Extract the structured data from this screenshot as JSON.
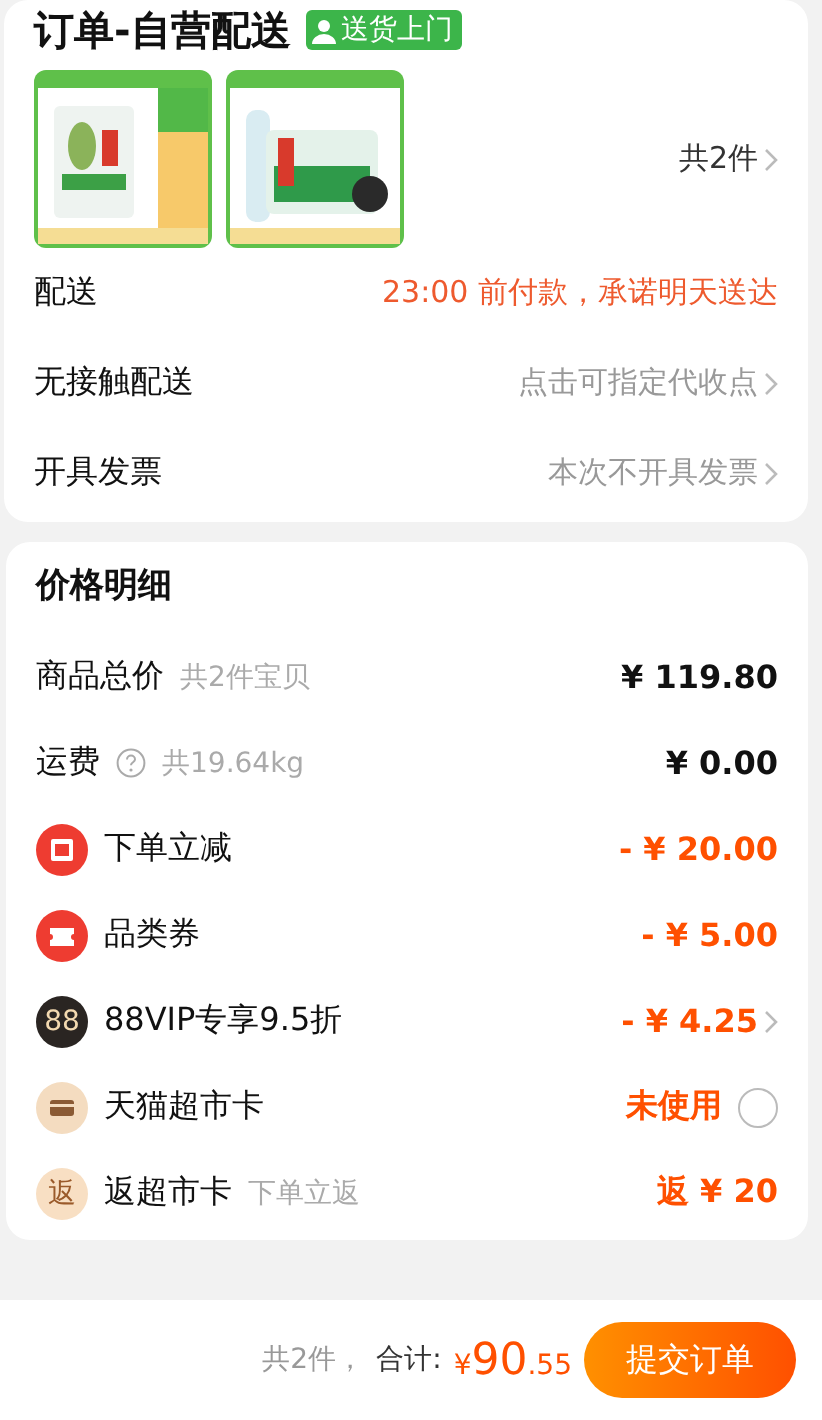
{
  "order": {
    "title": "订单-自营配送",
    "badge": "送货上门",
    "count": "共2件",
    "rows": [
      {
        "label": "配送",
        "value": "23:00 前付款，承诺明天送达",
        "highlight": true,
        "chevron": false
      },
      {
        "label": "无接触配送",
        "value": "点击可指定代收点",
        "highlight": false,
        "chevron": true
      },
      {
        "label": "开具发票",
        "value": "本次不开具发票",
        "highlight": false,
        "chevron": true
      }
    ]
  },
  "price": {
    "title": "价格明细",
    "rows": [
      {
        "kind": "total",
        "label": "商品总价",
        "note": "共2件宝贝",
        "value": "¥ 119.80"
      },
      {
        "kind": "shipping",
        "label": "运费",
        "note": "共19.64kg",
        "value": "¥ 0.00"
      },
      {
        "kind": "reduce",
        "label": "下单立减",
        "value": "- ¥ 20.00"
      },
      {
        "kind": "coupon",
        "label": "品类券",
        "value": "- ¥ 5.00"
      },
      {
        "kind": "vip",
        "label": "88VIP专享9.5折",
        "value": "- ¥ 4.25",
        "icon_text": "88"
      },
      {
        "kind": "card",
        "label": "天猫超市卡",
        "value": "未使用",
        "selected": false
      },
      {
        "kind": "rebate",
        "label": "返超市卡",
        "note": "下单立返",
        "value": "返 ¥ 20",
        "icon_text": "返"
      }
    ]
  },
  "footer": {
    "count": "共2件，",
    "total_label": "合计:",
    "currency": "¥",
    "amount": "90",
    "decimals": ".55",
    "button": "提交订单"
  }
}
